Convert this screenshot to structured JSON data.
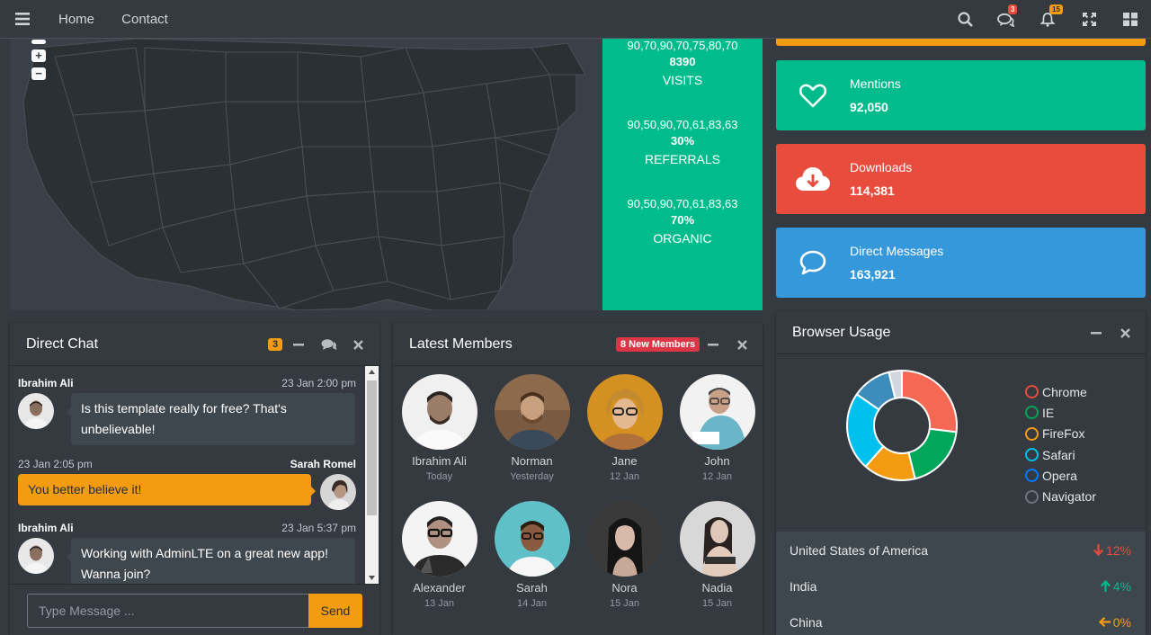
{
  "navbar": {
    "links": [
      "Home",
      "Contact"
    ],
    "messages_count": "3",
    "notifications_count": "15"
  },
  "map_stats": [
    {
      "spark": "90,70,90,70,75,80,70",
      "value": "8390",
      "label": "VISITS"
    },
    {
      "spark": "90,50,90,70,61,83,63",
      "value": "30%",
      "label": "REFERRALS"
    },
    {
      "spark": "90,50,90,70,61,83,63",
      "value": "70%",
      "label": "ORGANIC"
    }
  ],
  "info_boxes": [
    {
      "label": "Mentions",
      "value": "92,050",
      "icon": "heart-icon",
      "color": "#00bc8c"
    },
    {
      "label": "Downloads",
      "value": "114,381",
      "icon": "cloud-download-icon",
      "color": "#e74c3c"
    },
    {
      "label": "Direct Messages",
      "value": "163,921",
      "icon": "comment-icon",
      "color": "#3498db"
    }
  ],
  "direct_chat": {
    "title": "Direct Chat",
    "badge": "3",
    "messages": [
      {
        "name": "Ibrahim Ali",
        "time": "23 Jan 2:00 pm",
        "text": "Is this template really for free? That's unbelievable!",
        "side": "left"
      },
      {
        "name": "Sarah Romel",
        "time": "23 Jan 2:05 pm",
        "text": "You better believe it!",
        "side": "right"
      },
      {
        "name": "Ibrahim Ali",
        "time": "23 Jan 5:37 pm",
        "text": "Working with AdminLTE on a great new app! Wanna join?",
        "side": "left"
      }
    ],
    "input_placeholder": "Type Message ...",
    "send_label": "Send"
  },
  "latest_members": {
    "title": "Latest Members",
    "badge": "8 New Members",
    "members": [
      {
        "name": "Ibrahim Ali",
        "date": "Today"
      },
      {
        "name": "Norman",
        "date": "Yesterday"
      },
      {
        "name": "Jane",
        "date": "12 Jan"
      },
      {
        "name": "John",
        "date": "12 Jan"
      },
      {
        "name": "Alexander",
        "date": "13 Jan"
      },
      {
        "name": "Sarah",
        "date": "14 Jan"
      },
      {
        "name": "Nora",
        "date": "15 Jan"
      },
      {
        "name": "Nadia",
        "date": "15 Jan"
      }
    ]
  },
  "browser_usage": {
    "title": "Browser Usage",
    "legend": [
      {
        "name": "Chrome",
        "color": "#e74c3c"
      },
      {
        "name": "IE",
        "color": "#00a65a"
      },
      {
        "name": "FireFox",
        "color": "#f39c12"
      },
      {
        "name": "Safari",
        "color": "#00c0ef"
      },
      {
        "name": "Opera",
        "color": "#3c8dbc"
      },
      {
        "name": "Navigator",
        "color": "#d2d6de"
      }
    ],
    "countries": [
      {
        "name": "United States of America",
        "change": "12%",
        "direction": "down",
        "color": "#e74c3c"
      },
      {
        "name": "India",
        "change": "4%",
        "direction": "up",
        "color": "#00bc8c"
      },
      {
        "name": "China",
        "change": "0%",
        "direction": "left",
        "color": "#f39c12"
      }
    ]
  },
  "chart_data": {
    "type": "pie",
    "categories": [
      "Chrome",
      "IE",
      "FireFox",
      "Safari",
      "Opera",
      "Navigator"
    ],
    "values": [
      700,
      500,
      400,
      600,
      300,
      100
    ]
  }
}
